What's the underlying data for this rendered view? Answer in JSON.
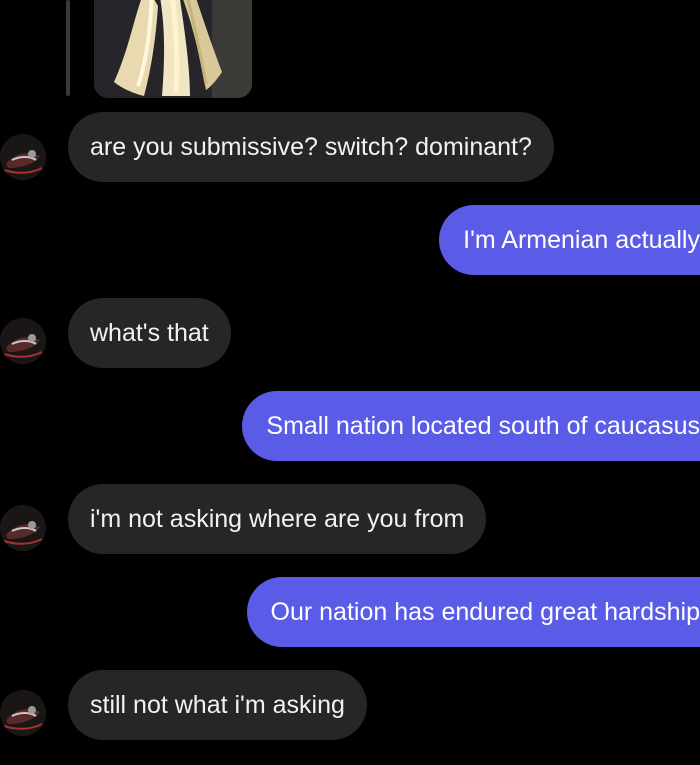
{
  "conversation": {
    "messages": [
      {
        "side": "received",
        "text": "are you submissive? switch? dominant?"
      },
      {
        "side": "sent",
        "text": "I'm Armenian actually"
      },
      {
        "side": "received",
        "text": "what's that"
      },
      {
        "side": "sent",
        "text": "Small nation located south of caucasus"
      },
      {
        "side": "received",
        "text": "i'm not asking where are you from"
      },
      {
        "side": "sent",
        "text": "Our nation has endured great hardship"
      },
      {
        "side": "received",
        "text": "still not what i'm asking"
      }
    ]
  },
  "colors": {
    "background": "#000000",
    "received_bubble": "#262626",
    "sent_bubble": "#5a5ce8",
    "text": "#ffffff"
  },
  "icons": {
    "avatar": "profile-avatar-icon",
    "photo": "shared-photo-thumbnail"
  }
}
